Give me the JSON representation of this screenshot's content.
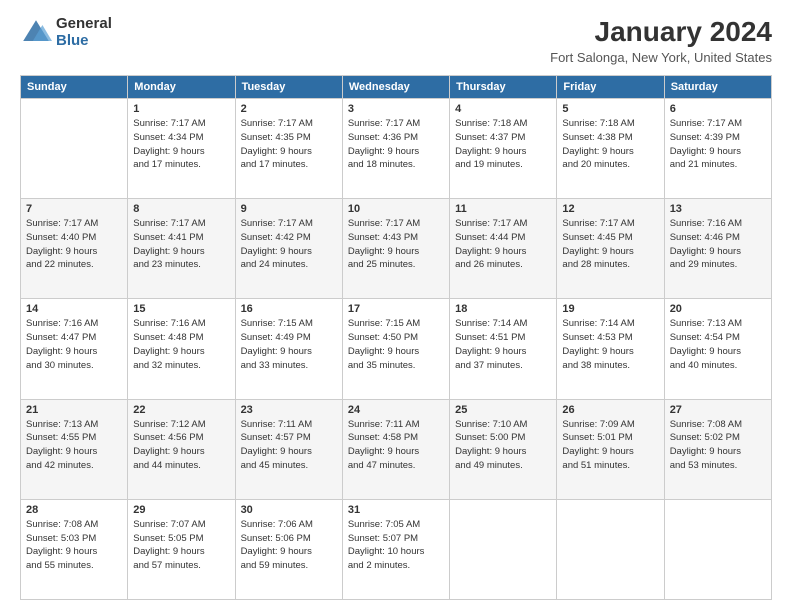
{
  "logo": {
    "general": "General",
    "blue": "Blue"
  },
  "title": "January 2024",
  "subtitle": "Fort Salonga, New York, United States",
  "headers": [
    "Sunday",
    "Monday",
    "Tuesday",
    "Wednesday",
    "Thursday",
    "Friday",
    "Saturday"
  ],
  "weeks": [
    [
      {
        "day": "",
        "info": ""
      },
      {
        "day": "1",
        "info": "Sunrise: 7:17 AM\nSunset: 4:34 PM\nDaylight: 9 hours\nand 17 minutes."
      },
      {
        "day": "2",
        "info": "Sunrise: 7:17 AM\nSunset: 4:35 PM\nDaylight: 9 hours\nand 17 minutes."
      },
      {
        "day": "3",
        "info": "Sunrise: 7:17 AM\nSunset: 4:36 PM\nDaylight: 9 hours\nand 18 minutes."
      },
      {
        "day": "4",
        "info": "Sunrise: 7:18 AM\nSunset: 4:37 PM\nDaylight: 9 hours\nand 19 minutes."
      },
      {
        "day": "5",
        "info": "Sunrise: 7:18 AM\nSunset: 4:38 PM\nDaylight: 9 hours\nand 20 minutes."
      },
      {
        "day": "6",
        "info": "Sunrise: 7:17 AM\nSunset: 4:39 PM\nDaylight: 9 hours\nand 21 minutes."
      }
    ],
    [
      {
        "day": "7",
        "info": "Sunrise: 7:17 AM\nSunset: 4:40 PM\nDaylight: 9 hours\nand 22 minutes."
      },
      {
        "day": "8",
        "info": "Sunrise: 7:17 AM\nSunset: 4:41 PM\nDaylight: 9 hours\nand 23 minutes."
      },
      {
        "day": "9",
        "info": "Sunrise: 7:17 AM\nSunset: 4:42 PM\nDaylight: 9 hours\nand 24 minutes."
      },
      {
        "day": "10",
        "info": "Sunrise: 7:17 AM\nSunset: 4:43 PM\nDaylight: 9 hours\nand 25 minutes."
      },
      {
        "day": "11",
        "info": "Sunrise: 7:17 AM\nSunset: 4:44 PM\nDaylight: 9 hours\nand 26 minutes."
      },
      {
        "day": "12",
        "info": "Sunrise: 7:17 AM\nSunset: 4:45 PM\nDaylight: 9 hours\nand 28 minutes."
      },
      {
        "day": "13",
        "info": "Sunrise: 7:16 AM\nSunset: 4:46 PM\nDaylight: 9 hours\nand 29 minutes."
      }
    ],
    [
      {
        "day": "14",
        "info": "Sunrise: 7:16 AM\nSunset: 4:47 PM\nDaylight: 9 hours\nand 30 minutes."
      },
      {
        "day": "15",
        "info": "Sunrise: 7:16 AM\nSunset: 4:48 PM\nDaylight: 9 hours\nand 32 minutes."
      },
      {
        "day": "16",
        "info": "Sunrise: 7:15 AM\nSunset: 4:49 PM\nDaylight: 9 hours\nand 33 minutes."
      },
      {
        "day": "17",
        "info": "Sunrise: 7:15 AM\nSunset: 4:50 PM\nDaylight: 9 hours\nand 35 minutes."
      },
      {
        "day": "18",
        "info": "Sunrise: 7:14 AM\nSunset: 4:51 PM\nDaylight: 9 hours\nand 37 minutes."
      },
      {
        "day": "19",
        "info": "Sunrise: 7:14 AM\nSunset: 4:53 PM\nDaylight: 9 hours\nand 38 minutes."
      },
      {
        "day": "20",
        "info": "Sunrise: 7:13 AM\nSunset: 4:54 PM\nDaylight: 9 hours\nand 40 minutes."
      }
    ],
    [
      {
        "day": "21",
        "info": "Sunrise: 7:13 AM\nSunset: 4:55 PM\nDaylight: 9 hours\nand 42 minutes."
      },
      {
        "day": "22",
        "info": "Sunrise: 7:12 AM\nSunset: 4:56 PM\nDaylight: 9 hours\nand 44 minutes."
      },
      {
        "day": "23",
        "info": "Sunrise: 7:11 AM\nSunset: 4:57 PM\nDaylight: 9 hours\nand 45 minutes."
      },
      {
        "day": "24",
        "info": "Sunrise: 7:11 AM\nSunset: 4:58 PM\nDaylight: 9 hours\nand 47 minutes."
      },
      {
        "day": "25",
        "info": "Sunrise: 7:10 AM\nSunset: 5:00 PM\nDaylight: 9 hours\nand 49 minutes."
      },
      {
        "day": "26",
        "info": "Sunrise: 7:09 AM\nSunset: 5:01 PM\nDaylight: 9 hours\nand 51 minutes."
      },
      {
        "day": "27",
        "info": "Sunrise: 7:08 AM\nSunset: 5:02 PM\nDaylight: 9 hours\nand 53 minutes."
      }
    ],
    [
      {
        "day": "28",
        "info": "Sunrise: 7:08 AM\nSunset: 5:03 PM\nDaylight: 9 hours\nand 55 minutes."
      },
      {
        "day": "29",
        "info": "Sunrise: 7:07 AM\nSunset: 5:05 PM\nDaylight: 9 hours\nand 57 minutes."
      },
      {
        "day": "30",
        "info": "Sunrise: 7:06 AM\nSunset: 5:06 PM\nDaylight: 9 hours\nand 59 minutes."
      },
      {
        "day": "31",
        "info": "Sunrise: 7:05 AM\nSunset: 5:07 PM\nDaylight: 10 hours\nand 2 minutes."
      },
      {
        "day": "",
        "info": ""
      },
      {
        "day": "",
        "info": ""
      },
      {
        "day": "",
        "info": ""
      }
    ]
  ]
}
